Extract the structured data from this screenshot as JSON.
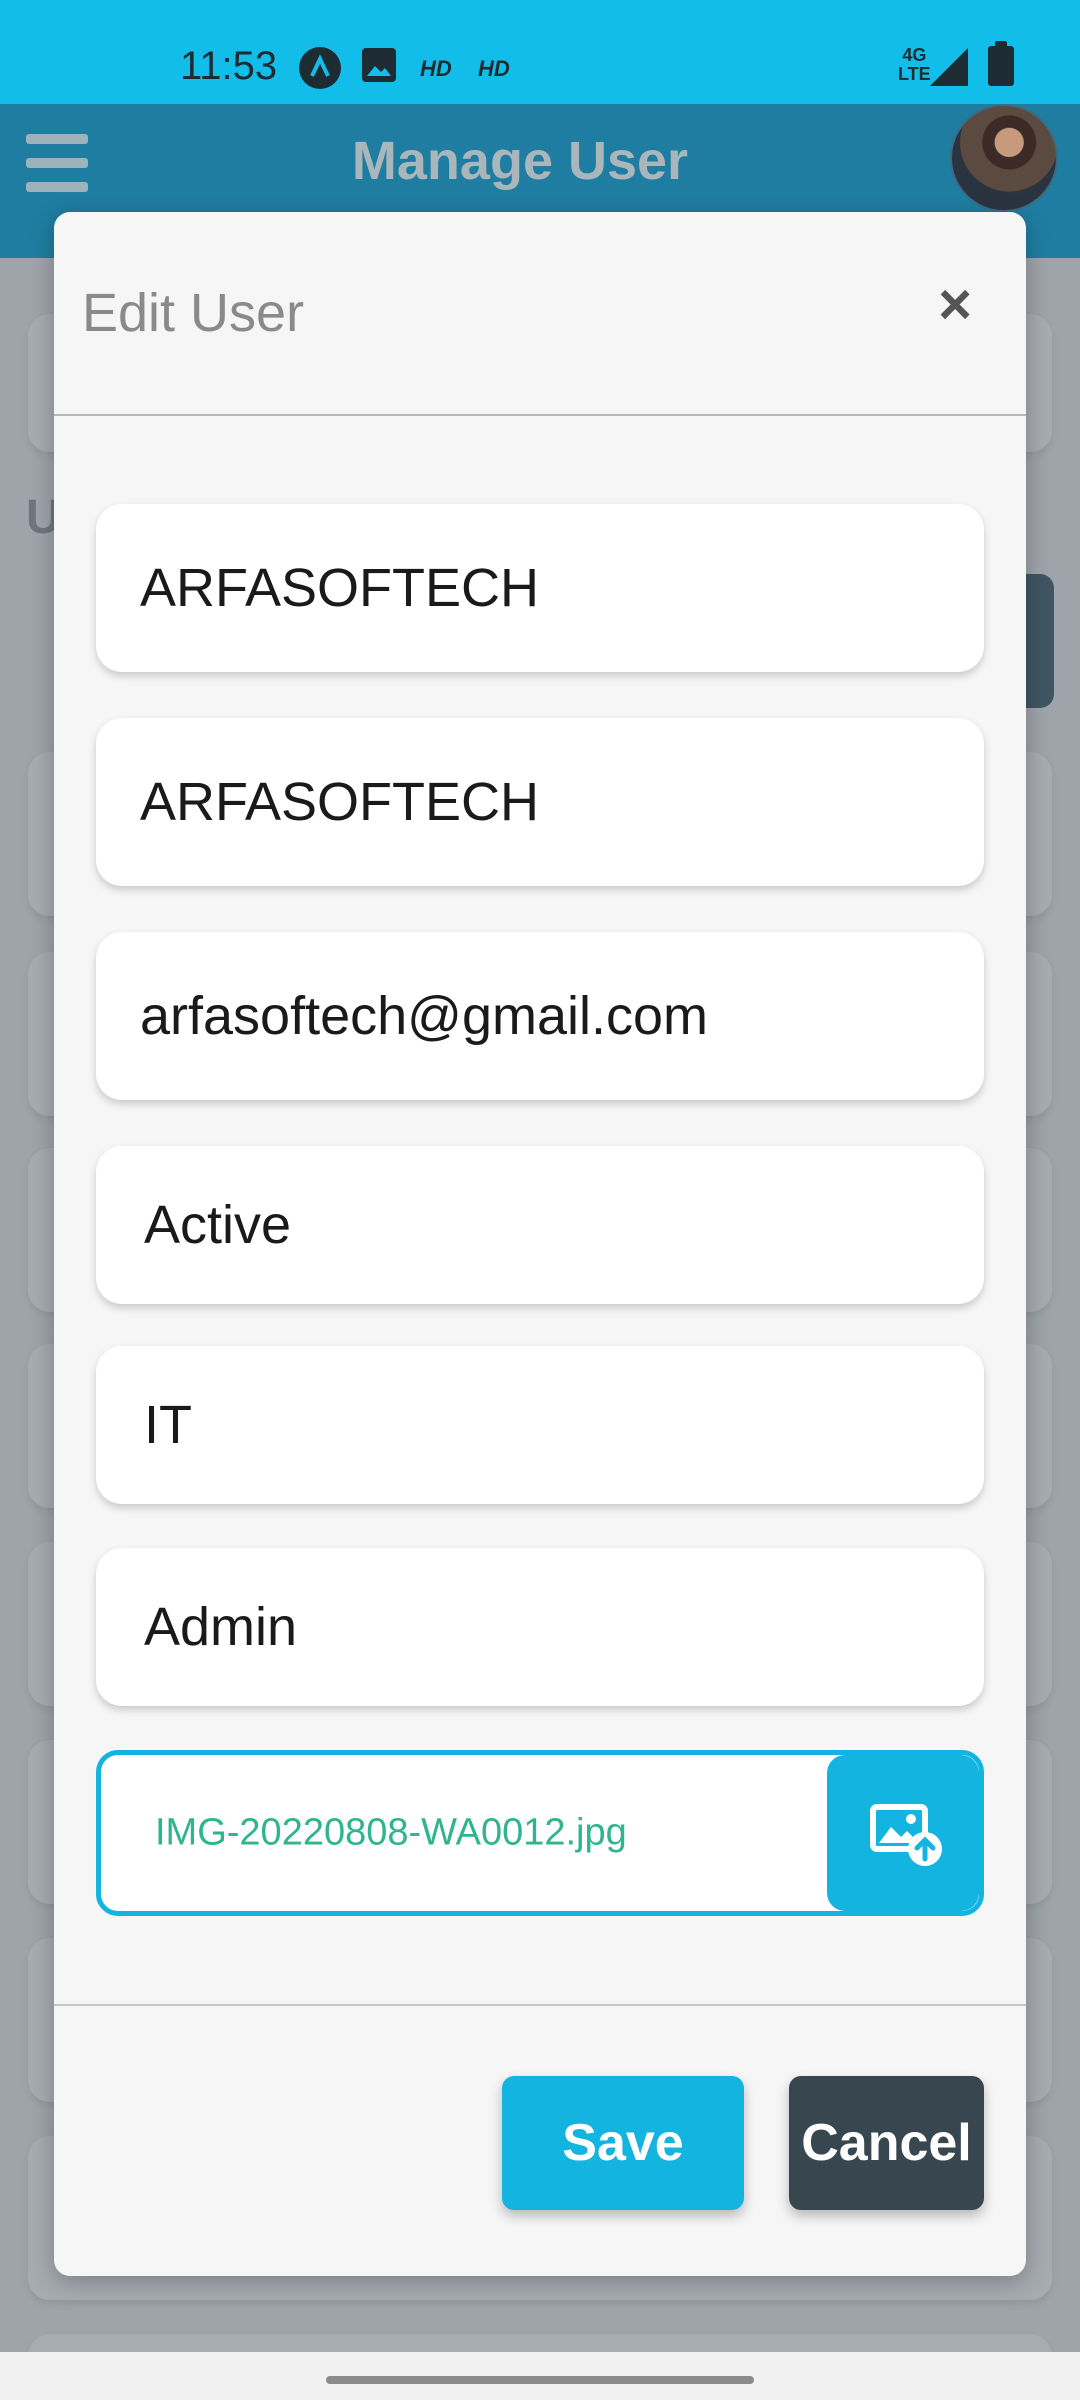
{
  "status_bar": {
    "time": "11:53",
    "network_top": "4G",
    "network_bottom": "LTE",
    "hd1": "HD",
    "hd2": "HD"
  },
  "app_bar": {
    "title": "Manage User"
  },
  "background": {
    "letter": "U"
  },
  "modal": {
    "title": "Edit User",
    "fields": [
      "ARFASOFTECH",
      "ARFASOFTECH",
      "arfasoftech@gmail.com",
      "Active",
      "IT",
      "Admin"
    ],
    "file_name": "IMG-20220808-WA0012.jpg",
    "save_label": "Save",
    "cancel_label": "Cancel"
  },
  "colors": {
    "accent": "#13b5e0",
    "app_bar": "#1f7da1",
    "cancel": "#37464f",
    "file_text": "#2eb58e"
  },
  "icons": {
    "menu": "hamburger-menu-icon",
    "close": "close-icon",
    "upload": "image-upload-icon"
  }
}
